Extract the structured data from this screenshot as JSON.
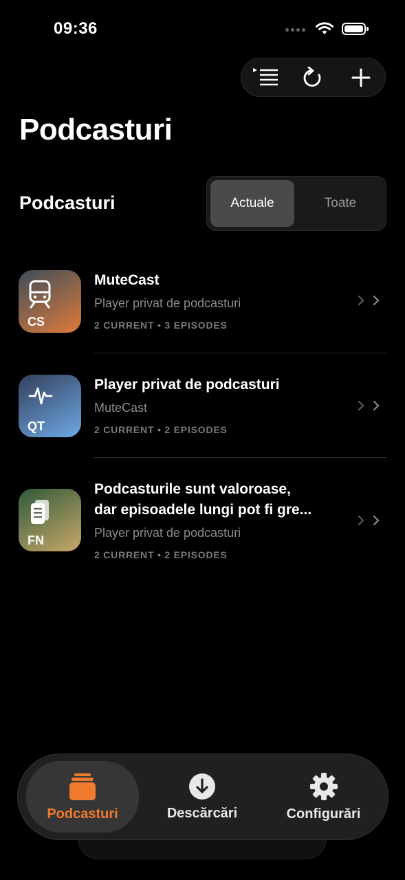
{
  "status": {
    "time": "09:36"
  },
  "header": {
    "title": "Podcasturi"
  },
  "toolbar": {
    "icons": [
      "queue-list-icon",
      "refresh-icon",
      "plus-icon"
    ]
  },
  "section": {
    "title": "Podcasturi",
    "segments": {
      "actuale": "Actuale",
      "toate": "Toate"
    },
    "selected": "Actuale"
  },
  "podcasts": [
    {
      "abbr": "CS",
      "title": "MuteCast",
      "subtitle": "Player privat de podcasturi",
      "meta": "2 CURRENT • 3 EPISODES",
      "gradient": [
        "#3d4e5a",
        "#e07a3a"
      ]
    },
    {
      "abbr": "QT",
      "title": "Player privat de podcasturi",
      "subtitle": "MuteCast",
      "meta": "2 CURRENT • 2 EPISODES",
      "gradient": [
        "#33405a",
        "#6ea8e6"
      ]
    },
    {
      "abbr": "FN",
      "title_line1": "Podcasturile sunt valoroase,",
      "title_line2": "dar episoadele lungi pot fi gre...",
      "subtitle": "Player privat de podcasturi",
      "meta": "2 CURRENT • 2 EPISODES",
      "gradient": [
        "#2f5a3a",
        "#c9a86a"
      ]
    }
  ],
  "tabs": {
    "podcasturi": "Podcasturi",
    "descarcari": "Descărcări",
    "configurari": "Configurări"
  },
  "colors": {
    "accent": "#f07a2e",
    "background": "#000000"
  }
}
